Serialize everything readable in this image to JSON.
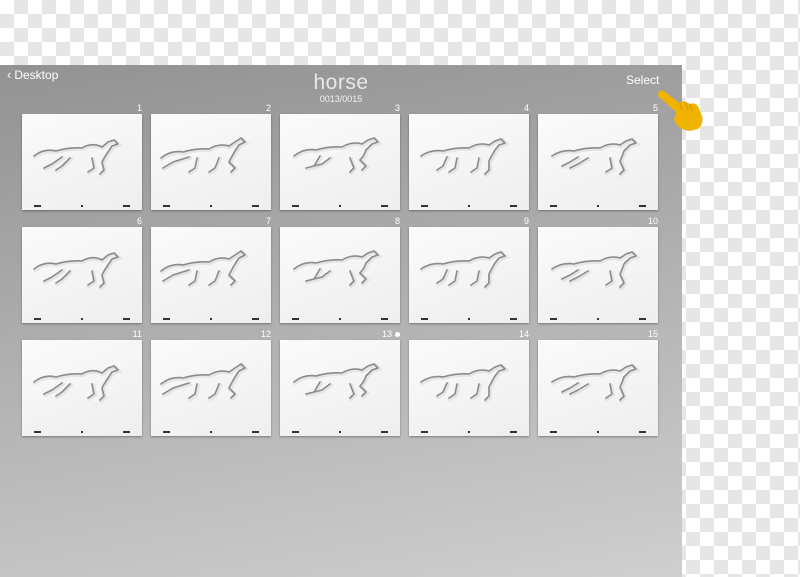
{
  "nav": {
    "back_label": "Desktop",
    "select_label": "Select"
  },
  "project": {
    "title": "horse",
    "frame_counter": "0013/0015"
  },
  "frames": [
    {
      "number": "1"
    },
    {
      "number": "2"
    },
    {
      "number": "3"
    },
    {
      "number": "4"
    },
    {
      "number": "5"
    },
    {
      "number": "6"
    },
    {
      "number": "7"
    },
    {
      "number": "8"
    },
    {
      "number": "9"
    },
    {
      "number": "10"
    },
    {
      "number": "11"
    },
    {
      "number": "12"
    },
    {
      "number": "13",
      "current": true
    },
    {
      "number": "14"
    },
    {
      "number": "15"
    }
  ],
  "icons": {
    "back": "chevron-left-icon",
    "pointer": "pointing-hand-icon"
  },
  "colors": {
    "pointer_hand": "#f0b400",
    "panel": "#a8a8a8"
  }
}
